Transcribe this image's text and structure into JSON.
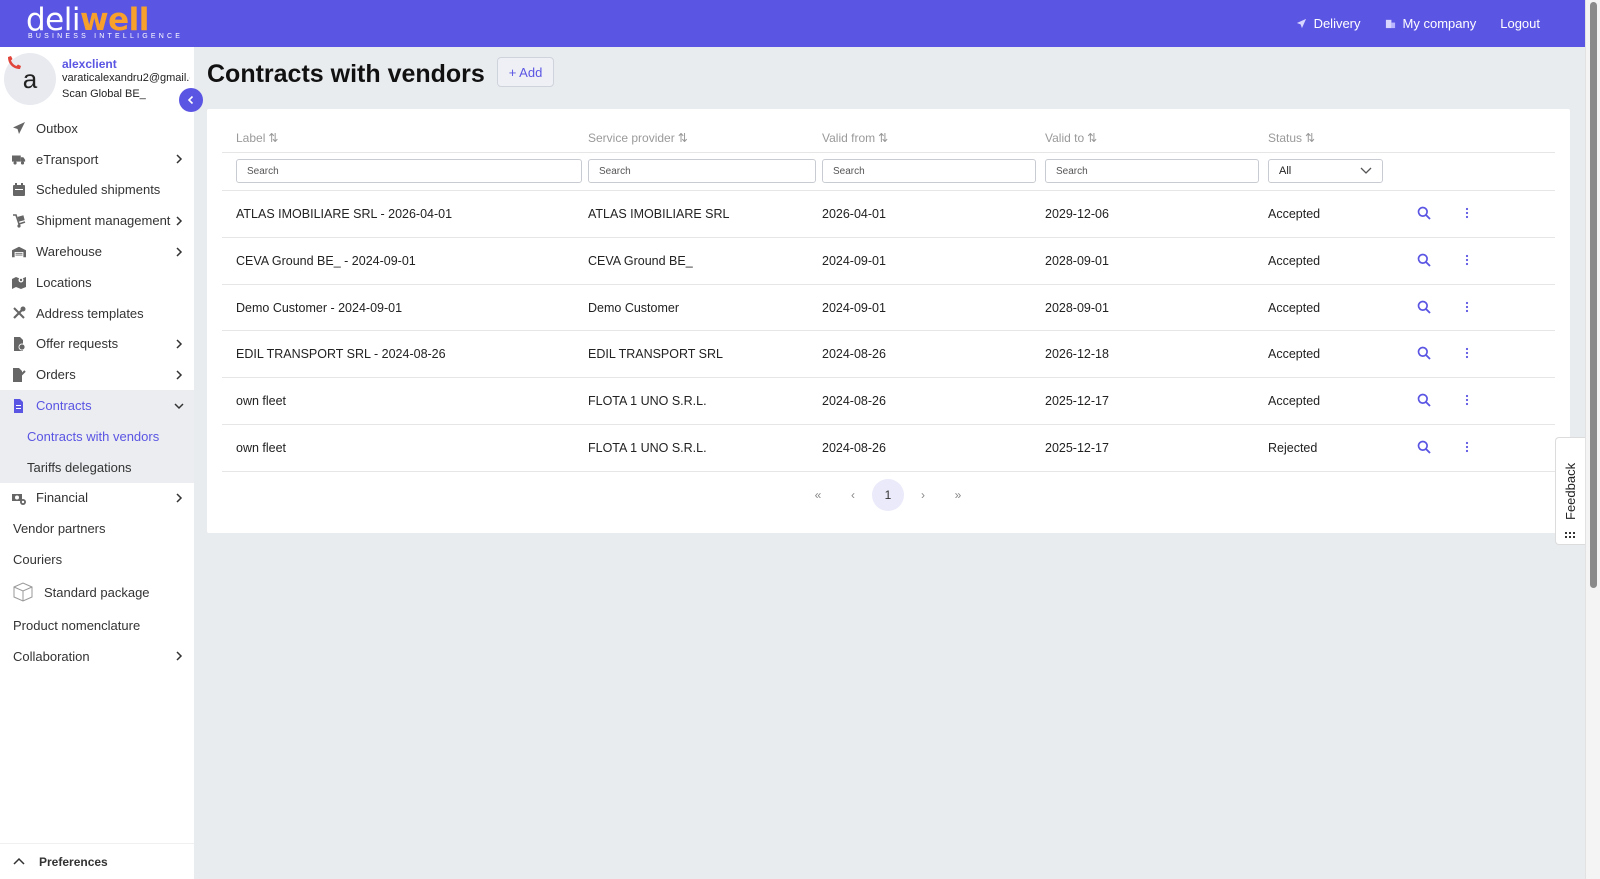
{
  "brand": {
    "logo_main_1": "deli",
    "logo_main_2": "well",
    "logo_tagline": "BUSINESS INTELLIGENCE",
    "primary_color": "#5b55e3",
    "accent_color": "#f7a02b"
  },
  "topnav": {
    "items": [
      {
        "label": "Delivery",
        "icon": "paper-plane-icon"
      },
      {
        "label": "My company",
        "icon": "building-icon"
      },
      {
        "label": "Logout"
      }
    ]
  },
  "profile": {
    "avatar_letter": "a",
    "username": "alexclient",
    "email": "varaticalexandru2@gmail.com",
    "company": "Scan Global BE_"
  },
  "sidebar": {
    "items": [
      {
        "label": "Outbox",
        "icon": "paper-plane-icon",
        "has_children": false
      },
      {
        "label": "eTransport",
        "icon": "truck-icon",
        "has_children": true
      },
      {
        "label": "Scheduled shipments",
        "icon": "calendar-icon",
        "has_children": false
      },
      {
        "label": "Shipment management",
        "icon": "hand-truck-icon",
        "has_children": true
      },
      {
        "label": "Warehouse",
        "icon": "warehouse-icon",
        "has_children": true
      },
      {
        "label": "Locations",
        "icon": "map-location-icon",
        "has_children": false
      },
      {
        "label": "Address templates",
        "icon": "tools-icon",
        "has_children": false
      },
      {
        "label": "Offer requests",
        "icon": "file-dollar-icon",
        "has_children": true
      },
      {
        "label": "Orders",
        "icon": "file-signature-icon",
        "has_children": true
      },
      {
        "label": "Contracts",
        "icon": "file-contract-icon",
        "has_children": true,
        "expanded": true,
        "active": true
      },
      {
        "label": "Contracts with vendors",
        "sub": true,
        "current": true
      },
      {
        "label": "Tariffs delegations",
        "sub": true
      },
      {
        "label": "Financial",
        "icon": "money-cog-icon",
        "has_children": true
      },
      {
        "label": "Vendor partners",
        "has_children": false
      },
      {
        "label": "Couriers",
        "has_children": false
      },
      {
        "label": "Standard package",
        "icon": "package-box-icon",
        "has_children": false
      },
      {
        "label": "Product nomenclature",
        "has_children": false
      },
      {
        "label": "Collaboration",
        "has_children": true
      }
    ],
    "preferences_label": "Preferences"
  },
  "page": {
    "title": "Contracts with vendors",
    "add_label": "+ Add"
  },
  "table": {
    "columns": [
      "Label",
      "Service provider",
      "Valid from",
      "Valid to",
      "Status"
    ],
    "filter_placeholder": "Search",
    "status_filter_value": "All",
    "rows": [
      {
        "label": "ATLAS IMOBILIARE SRL - 2026-04-01",
        "provider": "ATLAS IMOBILIARE SRL",
        "valid_from": "2026-04-01",
        "valid_to": "2029-12-06",
        "status": "Accepted"
      },
      {
        "label": "CEVA Ground BE_ - 2024-09-01",
        "provider": "CEVA Ground BE_",
        "valid_from": "2024-09-01",
        "valid_to": "2028-09-01",
        "status": "Accepted"
      },
      {
        "label": "Demo Customer - 2024-09-01",
        "provider": "Demo Customer",
        "valid_from": "2024-09-01",
        "valid_to": "2028-09-01",
        "status": "Accepted"
      },
      {
        "label": "EDIL TRANSPORT SRL - 2024-08-26",
        "provider": "EDIL TRANSPORT SRL",
        "valid_from": "2024-08-26",
        "valid_to": "2026-12-18",
        "status": "Accepted"
      },
      {
        "label": "own fleet",
        "provider": "FLOTA 1 UNO S.R.L.",
        "valid_from": "2024-08-26",
        "valid_to": "2025-12-17",
        "status": "Accepted"
      },
      {
        "label": "own fleet",
        "provider": "FLOTA 1 UNO S.R.L.",
        "valid_from": "2024-08-26",
        "valid_to": "2025-12-17",
        "status": "Rejected"
      }
    ]
  },
  "pagination": {
    "current_page": "1"
  },
  "feedback": {
    "label": "Feedback"
  }
}
